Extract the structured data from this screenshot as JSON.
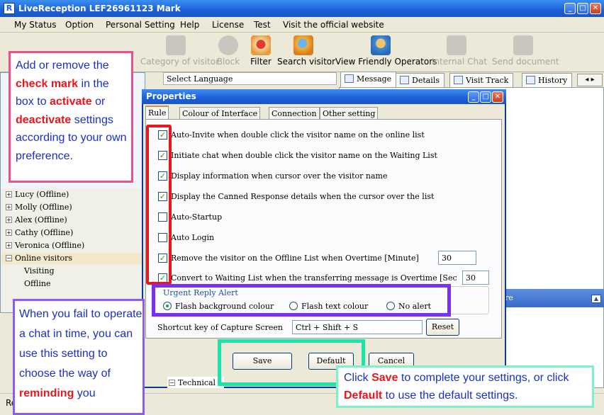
{
  "window": {
    "title": "LiveReception   LEF26961123 Mark",
    "controls": [
      "_",
      "□",
      "✕"
    ]
  },
  "menu": [
    "My Status",
    "Option",
    "Personal Setting",
    "Help",
    "License",
    "Test",
    "Visit the official website"
  ],
  "toolbar": {
    "items": [
      {
        "label": "Category of visitor",
        "disabled": true
      },
      {
        "label": "Block",
        "disabled": true
      },
      {
        "label": "Filter",
        "disabled": false
      },
      {
        "label": "Search visitor",
        "disabled": false
      },
      {
        "label": "View Friendly Operators",
        "disabled": false
      },
      {
        "label": "Internal Chat",
        "disabled": true
      },
      {
        "label": "Send document",
        "disabled": true
      }
    ]
  },
  "select_language": "Select Language",
  "right_tabs": [
    "Message",
    "Details",
    "Visit Track",
    "History"
  ],
  "tree": {
    "operators": [
      "Lucy (Offline)",
      "Molly (Offline)",
      "Alex (Offline)",
      "Cathy (Offline)",
      "Veronica (Offline)"
    ],
    "online_visitors": "Online visitors",
    "children": [
      "Visiting",
      "Offline"
    ],
    "technical": "Technical"
  },
  "lower_pane_fragment": "re",
  "status_fragment": "Re",
  "dialog": {
    "title": "Properties",
    "tabs": [
      "Rule",
      "Colour of Interface",
      "Connection",
      "Other setting"
    ],
    "options": [
      {
        "text": "Auto-Invite when double click the visitor name on the online list",
        "checked": true
      },
      {
        "text": "Initiate chat when double click the visitor name on the Waiting List",
        "checked": true
      },
      {
        "text": "Display information when cursor over the visitor name",
        "checked": true
      },
      {
        "text": "Display the Canned Response details when the cursor over the list",
        "checked": true
      },
      {
        "text": "Auto-Startup",
        "checked": false
      },
      {
        "text": "Auto Login",
        "checked": false
      },
      {
        "text": "Remove the visitor on the Offline List when Overtime [Minute]",
        "checked": true,
        "value": "30"
      },
      {
        "text": "Convert to Waiting List when the transferring message is Overtime [Sec",
        "checked": true,
        "value": "30"
      }
    ],
    "alert": {
      "legend": "Urgent Reply Alert",
      "choices": [
        "Flash background colour",
        "Flash text colour",
        "No alert"
      ],
      "selected": "Flash background colour"
    },
    "shortcut": {
      "label": "Shortcut key of Capture Screen",
      "value": "Ctrl + Shift + S",
      "reset": "Reset"
    },
    "buttons": {
      "save": "Save",
      "default": "Default",
      "cancel": "Cancel"
    }
  },
  "annotations": {
    "top_left": {
      "p1": "Add or remove the ",
      "b1": "check mark",
      "p2": " in the box to ",
      "b2": "activate",
      "p3": " or ",
      "b3": "deactivate",
      "p4": " settings according to your own preference."
    },
    "bottom_left": {
      "p1": "When you fail to operate a chat in time, you can use this setting to choose the way of ",
      "b1": "reminding",
      "p2": " you"
    },
    "bottom_right": {
      "p1": "Click ",
      "b1": "Save",
      "p2": " to complete your settings, or click ",
      "b2": "Default",
      "p3": " to use the default settings."
    },
    "colors": {
      "pink": "#f0508a",
      "red": "#e8161d",
      "purple": "#7b2ff0",
      "green": "#19e6a6",
      "note_text": "#1a30c8"
    }
  }
}
